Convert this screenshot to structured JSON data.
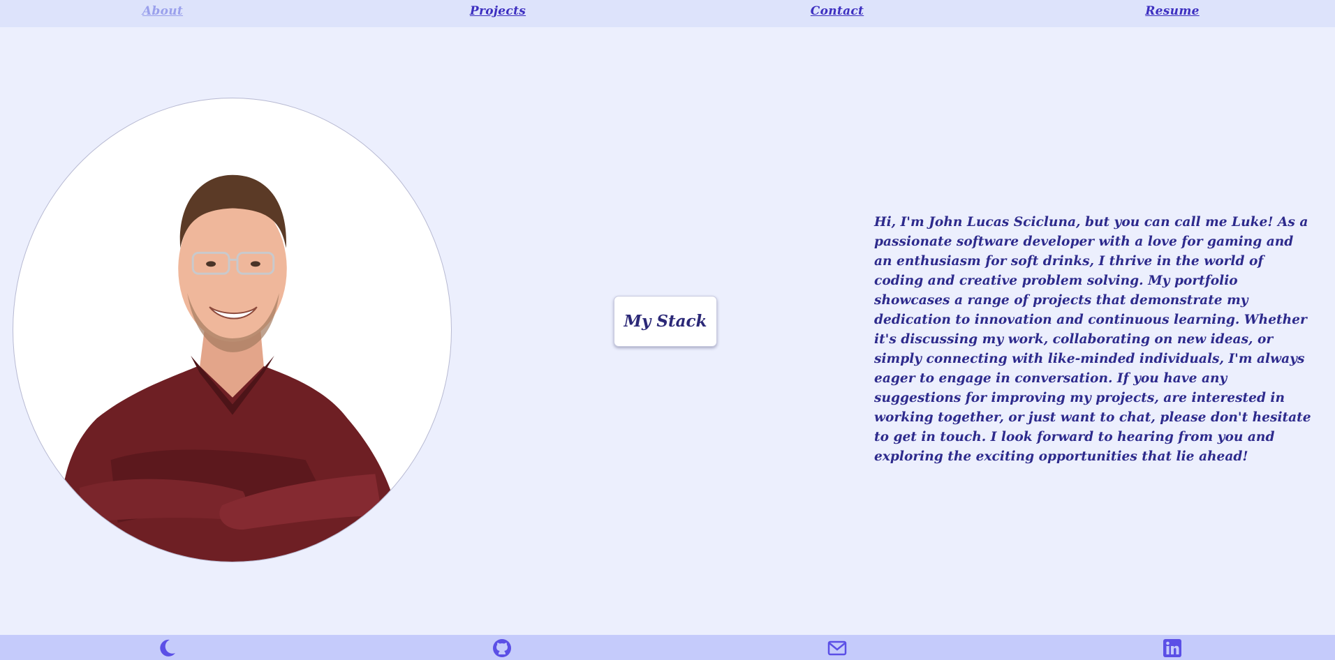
{
  "nav": {
    "items": [
      {
        "label": "About",
        "active": true
      },
      {
        "label": "Projects",
        "active": false
      },
      {
        "label": "Contact",
        "active": false
      },
      {
        "label": "Resume",
        "active": false
      }
    ]
  },
  "main": {
    "stack_button_label": "My Stack",
    "bio": "Hi, I'm John Lucas Scicluna, but you can call me Luke! As a passionate software developer with a love for gaming and an enthusiasm for soft drinks, I thrive in the world of coding and creative problem solving. My portfolio showcases a range of projects that demonstrate my dedication to innovation and continuous learning. Whether it's discussing my work, collaborating on new ideas, or simply connecting with like-minded individuals, I'm always eager to engage in conversation. If you have any suggestions for improving my projects, are interested in working together, or just want to chat, please don't hesitate to get in touch. I look forward to hearing from you and exploring the exciting opportunities that lie ahead!"
  },
  "footer": {
    "icons": [
      "moon-icon",
      "github-icon",
      "mail-icon",
      "linkedin-icon"
    ]
  },
  "colors": {
    "page_bg": "#eceffd",
    "nav_bg": "#dde3fb",
    "footer_bg": "#c5cbfb",
    "accent": "#3d2fc0",
    "nav_active": "#9aa0ec",
    "text": "#2d2a8c"
  }
}
